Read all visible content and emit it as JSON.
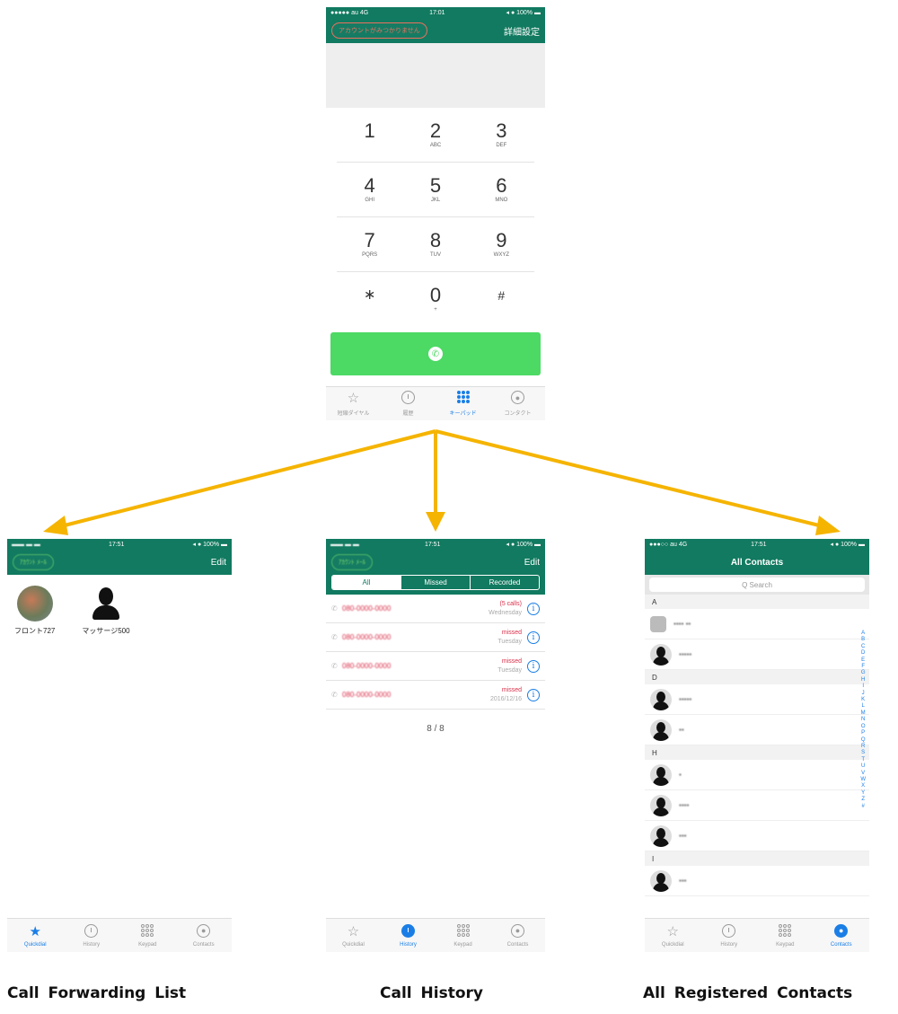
{
  "main": {
    "status": {
      "left": "●●●●● au 4G",
      "time": "17:01",
      "right": "◂ ● 100% ▬"
    },
    "account_pill": "アカウントがみつかりません",
    "advanced_link": "詳細設定",
    "keys": [
      {
        "digit": "1",
        "letters": ""
      },
      {
        "digit": "2",
        "letters": "ABC"
      },
      {
        "digit": "3",
        "letters": "DEF"
      },
      {
        "digit": "4",
        "letters": "GHI"
      },
      {
        "digit": "5",
        "letters": "JKL"
      },
      {
        "digit": "6",
        "letters": "MNO"
      },
      {
        "digit": "7",
        "letters": "PQRS"
      },
      {
        "digit": "8",
        "letters": "TUV"
      },
      {
        "digit": "9",
        "letters": "WXYZ"
      },
      {
        "digit": "∗",
        "letters": ""
      },
      {
        "digit": "0",
        "letters": "+"
      },
      {
        "digit": "#",
        "letters": ""
      }
    ],
    "call_icon": "phone-icon",
    "tabs": [
      {
        "label": "短縮ダイヤル",
        "icon": "star-icon"
      },
      {
        "label": "履歴",
        "icon": "clock-icon"
      },
      {
        "label": "キーパッド",
        "icon": "keypad-icon"
      },
      {
        "label": "コンタクト",
        "icon": "person-icon"
      }
    ]
  },
  "quickdial": {
    "status": {
      "left": "▬▬ ▬ ▬",
      "time": "17:51",
      "right": "◂ ● 100% ▬"
    },
    "pill": "ｱｶｳﾝﾄ ﾒｰﾙ",
    "edit": "Edit",
    "items": [
      {
        "name": "フロント727"
      },
      {
        "name": "マッサージ500"
      }
    ],
    "tabs": [
      {
        "label": "Quickdial"
      },
      {
        "label": "History"
      },
      {
        "label": "Keypad"
      },
      {
        "label": "Contacts"
      }
    ]
  },
  "history": {
    "status": {
      "left": "▬▬ ▬ ▬",
      "time": "17:51",
      "right": "◂ ● 100% ▬"
    },
    "pill": "ｱｶｳﾝﾄ ﾒｰﾙ",
    "edit": "Edit",
    "segments": [
      "All",
      "Missed",
      "Recorded"
    ],
    "rows": [
      {
        "number": "080-0000-0000",
        "status": "(5 calls)",
        "date": "Wednesday"
      },
      {
        "number": "080-0000-0000",
        "status": "missed",
        "date": "Tuesday"
      },
      {
        "number": "080-0000-0000",
        "status": "missed",
        "date": "Tuesday"
      },
      {
        "number": "080-0000-0000",
        "status": "missed",
        "date": "2016/12/16"
      }
    ],
    "pager": "8 / 8",
    "tabs": [
      {
        "label": "Quickdial"
      },
      {
        "label": "History"
      },
      {
        "label": "Keypad"
      },
      {
        "label": "Contacts"
      }
    ]
  },
  "contacts": {
    "status": {
      "left": "●●●○○ au 4G",
      "time": "17:51",
      "right": "◂ ● 100% ▬"
    },
    "title": "All Contacts",
    "search_placeholder": "Q Search",
    "sections": [
      {
        "letter": "A",
        "rows": [
          "▪▪▪▪ ▪▪",
          "▪▪▪▪▪"
        ]
      },
      {
        "letter": "D",
        "rows": [
          "▪▪▪▪▪",
          "▪▪"
        ]
      },
      {
        "letter": "H",
        "rows": [
          "▪",
          "▪▪▪▪",
          "▪▪▪"
        ]
      },
      {
        "letter": "I",
        "rows": [
          "▪▪▪"
        ]
      }
    ],
    "alphabet": [
      "A",
      "B",
      "C",
      "D",
      "E",
      "F",
      "G",
      "H",
      "I",
      "J",
      "K",
      "L",
      "M",
      "N",
      "O",
      "P",
      "Q",
      "R",
      "S",
      "T",
      "U",
      "V",
      "W",
      "X",
      "Y",
      "Z",
      "#"
    ],
    "tabs": [
      {
        "label": "Quickdial"
      },
      {
        "label": "History"
      },
      {
        "label": "Keypad"
      },
      {
        "label": "Contacts"
      }
    ]
  },
  "captions": {
    "left": "Call Forwarding List",
    "center": "Call History",
    "right": "All Registered Contacts"
  },
  "colors": {
    "header_green": "#117a60",
    "call_green": "#4cd964",
    "arrow": "#f5b400",
    "accent_blue": "#1a7ee6",
    "missed_red": "#d9304a"
  }
}
